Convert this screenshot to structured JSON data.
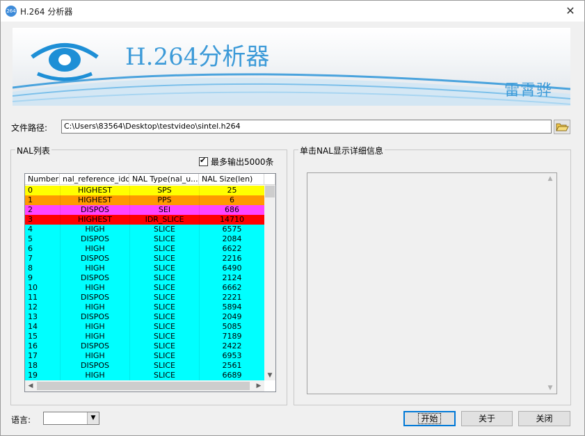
{
  "window": {
    "title": "H.264 分析器",
    "icon_text": "264",
    "close_glyph": "✕"
  },
  "banner": {
    "title": "H.264分析器",
    "author": "雷霄骅"
  },
  "file_path": {
    "label": "文件路径:",
    "value": "C:\\Users\\83564\\Desktop\\testvideo\\sintel.h264"
  },
  "nal_list": {
    "group_label": "NAL列表",
    "max_output_label": "最多输出5000条",
    "max_output_checked": true,
    "columns": [
      "Number",
      "nal_reference_idc",
      "NAL Type(nal_u...",
      "NAL Size(len)"
    ],
    "rows": [
      {
        "number": "0",
        "ref": "HIGHEST",
        "type": "SPS",
        "size": "25",
        "color": "#ffff00"
      },
      {
        "number": "1",
        "ref": "HIGHEST",
        "type": "PPS",
        "size": "6",
        "color": "#ff9900"
      },
      {
        "number": "2",
        "ref": "DISPOS",
        "type": "SEI",
        "size": "686",
        "color": "#ff44ff"
      },
      {
        "number": "3",
        "ref": "HIGHEST",
        "type": "IDR_SLICE",
        "size": "14710",
        "color": "#ff0000"
      },
      {
        "number": "4",
        "ref": "HIGH",
        "type": "SLICE",
        "size": "6575",
        "color": "#00ffff"
      },
      {
        "number": "5",
        "ref": "DISPOS",
        "type": "SLICE",
        "size": "2084",
        "color": "#00ffff"
      },
      {
        "number": "6",
        "ref": "HIGH",
        "type": "SLICE",
        "size": "6622",
        "color": "#00ffff"
      },
      {
        "number": "7",
        "ref": "DISPOS",
        "type": "SLICE",
        "size": "2216",
        "color": "#00ffff"
      },
      {
        "number": "8",
        "ref": "HIGH",
        "type": "SLICE",
        "size": "6490",
        "color": "#00ffff"
      },
      {
        "number": "9",
        "ref": "DISPOS",
        "type": "SLICE",
        "size": "2124",
        "color": "#00ffff"
      },
      {
        "number": "10",
        "ref": "HIGH",
        "type": "SLICE",
        "size": "6662",
        "color": "#00ffff"
      },
      {
        "number": "11",
        "ref": "DISPOS",
        "type": "SLICE",
        "size": "2221",
        "color": "#00ffff"
      },
      {
        "number": "12",
        "ref": "HIGH",
        "type": "SLICE",
        "size": "5894",
        "color": "#00ffff"
      },
      {
        "number": "13",
        "ref": "DISPOS",
        "type": "SLICE",
        "size": "2049",
        "color": "#00ffff"
      },
      {
        "number": "14",
        "ref": "HIGH",
        "type": "SLICE",
        "size": "5085",
        "color": "#00ffff"
      },
      {
        "number": "15",
        "ref": "HIGH",
        "type": "SLICE",
        "size": "7189",
        "color": "#00ffff"
      },
      {
        "number": "16",
        "ref": "DISPOS",
        "type": "SLICE",
        "size": "2422",
        "color": "#00ffff"
      },
      {
        "number": "17",
        "ref": "HIGH",
        "type": "SLICE",
        "size": "6953",
        "color": "#00ffff"
      },
      {
        "number": "18",
        "ref": "DISPOS",
        "type": "SLICE",
        "size": "2561",
        "color": "#00ffff"
      },
      {
        "number": "19",
        "ref": "HIGH",
        "type": "SLICE",
        "size": "6689",
        "color": "#00ffff"
      }
    ]
  },
  "detail": {
    "group_label": "单击NAL显示详细信息"
  },
  "language": {
    "label": "语言:",
    "value": ""
  },
  "buttons": {
    "start": "开始",
    "about": "关于",
    "close": "关闭"
  },
  "icons": {
    "browse": "folder-open-icon",
    "logo": "eye-icon"
  }
}
